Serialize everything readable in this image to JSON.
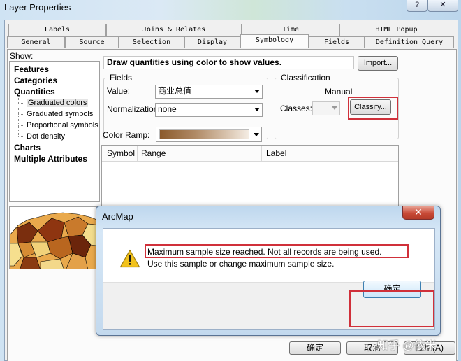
{
  "window": {
    "title": "Layer Properties",
    "help_label": "?",
    "close_label": "✕"
  },
  "tabs": {
    "row1": [
      "Labels",
      "Joins & Relates",
      "Time",
      "HTML Popup"
    ],
    "row2": [
      "General",
      "Source",
      "Selection",
      "Display",
      "Symbology",
      "Fields",
      "Definition Query"
    ],
    "active": "Symbology"
  },
  "show": {
    "label": "Show:",
    "features": "Features",
    "categories": "Categories",
    "quantities": "Quantities",
    "sub": [
      "Graduated colors",
      "Graduated symbols",
      "Proportional symbols",
      "Dot density"
    ],
    "charts": "Charts",
    "multiple": "Multiple Attributes"
  },
  "description": "Draw quantities using color to show values.",
  "import_label": "Import...",
  "fields": {
    "group_label": "Fields",
    "value_label": "Value:",
    "value": "商业总值",
    "normalization_label": "Normalization:",
    "normalization": "none"
  },
  "classification": {
    "group_label": "Classification",
    "method": "Manual",
    "classes_label": "Classes:",
    "classify_label": "Classify..."
  },
  "color_ramp_label": "Color Ramp:",
  "table": {
    "headers": [
      "Symbol",
      "Range",
      "Label"
    ]
  },
  "buttons": {
    "ok": "确定",
    "cancel": "取消",
    "apply": "应用(A)"
  },
  "dialog": {
    "title": "ArcMap",
    "close_label": "✕",
    "message1": "Maximum sample size reached. Not all records are being used.",
    "message2": "Use this sample or change maximum sample size.",
    "ok_label": "确定"
  },
  "watermark": "知乎 @依米",
  "colors": {
    "highlight_box": "#d0303a",
    "ramp_dark": "#8b5a2b",
    "ramp_light": "#f4ece3",
    "warning": "#f2c21b",
    "dialog_close": "#c84a37"
  },
  "icons": {
    "warning": "warning-icon",
    "dropdown": "chevron-down-icon"
  }
}
